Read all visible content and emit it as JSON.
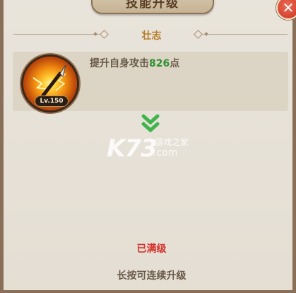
{
  "dialog": {
    "title": "技能升级",
    "close_symbol": "✕"
  },
  "skill": {
    "name": "壮志",
    "icon": "spear-lightning-icon",
    "level_label": "Lv.150",
    "effect_prefix": "提升自身攻击",
    "effect_value": "826",
    "effect_suffix": "点"
  },
  "upgrade_arrow_icon": "double-chevron-down-icon",
  "watermark": {
    "brand": "K73",
    "site_name": "游戏之家",
    "domain": ".com"
  },
  "status": {
    "maxed_text": "已满级",
    "hint_text": "长按可连续升级"
  },
  "colors": {
    "skill_name": "#b87d2a",
    "effect_value": "#2f8f32",
    "maxed": "#d6302a",
    "arrow": "#3fb44a"
  }
}
